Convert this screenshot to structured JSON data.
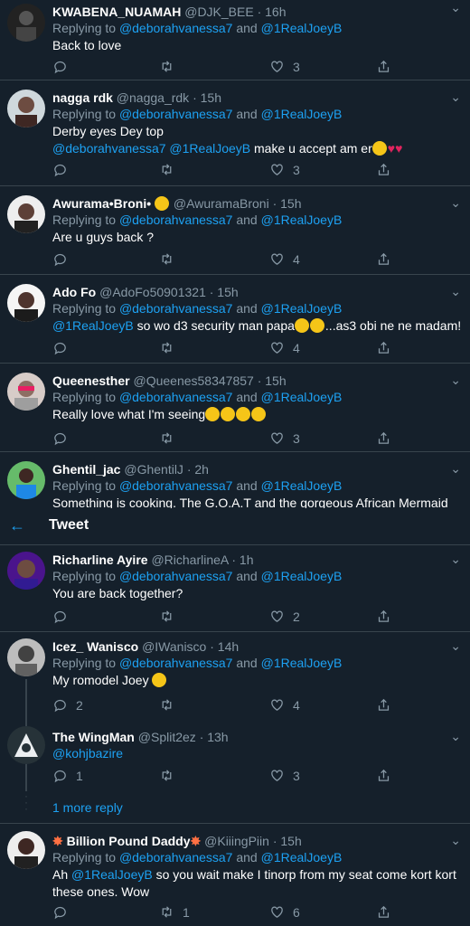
{
  "header": {
    "back_icon": "arrow-left-icon",
    "title": "Tweet"
  },
  "tweets": [
    {
      "name": "KWABENA_NUAMAH",
      "handle": "@DJK_BEE",
      "time": "· 16h",
      "reply_prefix": "Replying to",
      "reply_to_1": "@deborahvanessa7",
      "reply_and": "and",
      "reply_to_2": "@1RealJoeyB",
      "text": "Back to love",
      "replies": "",
      "retweets": "",
      "likes": "3"
    },
    {
      "name": "nagga rdk",
      "handle": "@nagga_rdk",
      "time": "· 15h",
      "reply_prefix": "Replying to",
      "reply_to_1": "@deborahvanessa7",
      "reply_and": "and",
      "reply_to_2": "@1RealJoeyB",
      "text": "Derby eyes Dey top",
      "mention_1": "@deborahvanessa7",
      "mention_2": "@1RealJoeyB",
      "text2": " make u accept am er",
      "replies": "",
      "retweets": "",
      "likes": "3"
    },
    {
      "name": "Awurama•Broni•",
      "handle": "@AwuramaBroni",
      "time": "· 15h",
      "reply_prefix": "Replying to",
      "reply_to_1": "@deborahvanessa7",
      "reply_and": "and",
      "reply_to_2": "@1RealJoeyB",
      "text": "Are u guys back ?",
      "replies": "",
      "retweets": "",
      "likes": "4"
    },
    {
      "name": "Ado Fo",
      "handle": "@AdoFo50901321",
      "time": "· 15h",
      "reply_prefix": "Replying to",
      "reply_to_1": "@deborahvanessa7",
      "reply_and": "and",
      "reply_to_2": "@1RealJoeyB",
      "mention_1": "@1RealJoeyB",
      "text": " so wo d3 security man papa",
      "text2": "...as3 obi ne ne madam!",
      "replies": "",
      "retweets": "",
      "likes": "4"
    },
    {
      "name": "Queenesther",
      "handle": "@Queenes58347857",
      "time": "· 15h",
      "reply_prefix": "Replying to",
      "reply_to_1": "@deborahvanessa7",
      "reply_and": "and",
      "reply_to_2": "@1RealJoeyB",
      "text": "Really love what I'm seeing",
      "replies": "",
      "retweets": "",
      "likes": "3"
    },
    {
      "name": "Ghentil_jac",
      "handle": "@GhentilJ",
      "time": "· 2h",
      "reply_prefix": "Replying to",
      "reply_to_1": "@deborahvanessa7",
      "reply_and": "and",
      "reply_to_2": "@1RealJoeyB",
      "text": "Something is cooking. The G.O.A.T and the gorgeous African Mermaid"
    },
    {
      "name": "Richarline Ayire",
      "handle": "@RicharlineA",
      "time": "· 1h",
      "reply_prefix": "Replying to",
      "reply_to_1": "@deborahvanessa7",
      "reply_and": "and",
      "reply_to_2": "@1RealJoeyB",
      "text": "You are back together?",
      "replies": "",
      "retweets": "",
      "likes": "2"
    },
    {
      "name": "Icez_ Wanisco",
      "handle": "@IWanisco",
      "time": "· 14h",
      "reply_prefix": "Replying to",
      "reply_to_1": "@deborahvanessa7",
      "reply_and": "and",
      "reply_to_2": "@1RealJoeyB",
      "text": "My romodel Joey",
      "replies": "2",
      "retweets": "",
      "likes": "4"
    },
    {
      "name": "The WingMan",
      "handle": "@Split2ez",
      "time": "· 13h",
      "mention_1": "@kohjbazire",
      "replies": "1",
      "retweets": "",
      "likes": "3"
    },
    {
      "name": "Billion Pound Daddy",
      "handle": "@KiiingPiin",
      "time": "· 15h",
      "reply_prefix": "Replying to",
      "reply_to_1": "@deborahvanessa7",
      "reply_and": "and",
      "reply_to_2": "@1RealJoeyB",
      "text_pre": "Ah ",
      "mention_1": "@1RealJoeyB",
      "text": " so you wait make I tinorp from my seat come kort kort",
      "text2": "these ones. Wow",
      "replies": "",
      "retweets": "1",
      "likes": "6"
    }
  ],
  "more_replies": "1 more reply",
  "colors": {
    "background": "#15202b",
    "link": "#1da1f2",
    "muted": "#8899a6",
    "divider": "#38444d"
  }
}
